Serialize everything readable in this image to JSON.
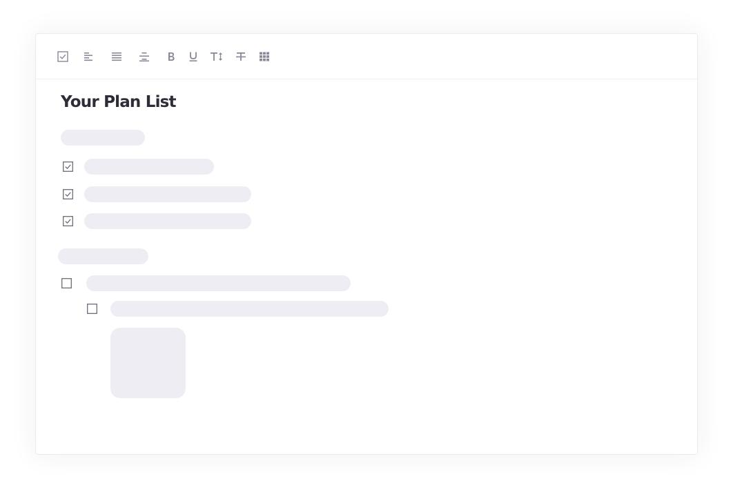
{
  "editor": {
    "title": "Your Plan List"
  },
  "toolbar": {
    "tools": [
      {
        "icon": "checkbox-icon"
      },
      {
        "icon": "align-left-icon"
      },
      {
        "icon": "align-justify-icon"
      },
      {
        "icon": "align-center-icon"
      },
      {
        "icon": "bold-icon"
      },
      {
        "icon": "underline-icon"
      },
      {
        "icon": "text-size-icon"
      },
      {
        "icon": "strikethrough-icon"
      },
      {
        "icon": "table-icon"
      }
    ]
  },
  "sections": [
    {
      "items": [
        {
          "checked": true
        },
        {
          "checked": true
        },
        {
          "checked": true
        }
      ]
    },
    {
      "items": [
        {
          "checked": false
        },
        {
          "checked": false,
          "nested": true
        }
      ]
    }
  ],
  "colors": {
    "text": "#2f2c38",
    "icon": "#8a8796",
    "placeholder": "#efedf4",
    "border": "#eceaf0"
  }
}
